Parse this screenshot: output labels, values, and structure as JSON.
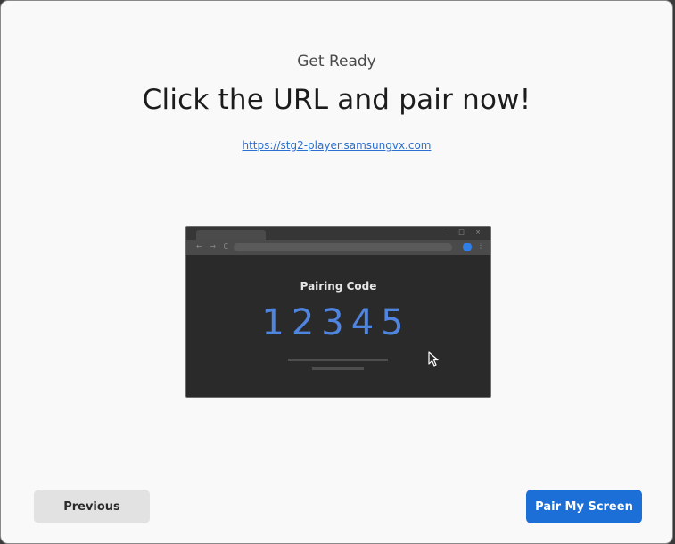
{
  "header": {
    "subtitle": "Get Ready",
    "title": "Click the URL and pair now!",
    "url": "https://stg2-player.samsungvx.com"
  },
  "illustration": {
    "window_controls": "_ □ ×",
    "nav_icons": "← → C",
    "menu_icon": "⋮",
    "pairing_label": "Pairing Code",
    "pairing_code": "12345",
    "profile_color": "#2f7fe8",
    "code_color": "#4f84df"
  },
  "footer": {
    "previous_label": "Previous",
    "pair_label": "Pair My Screen",
    "accent_color": "#1c6fd6"
  }
}
